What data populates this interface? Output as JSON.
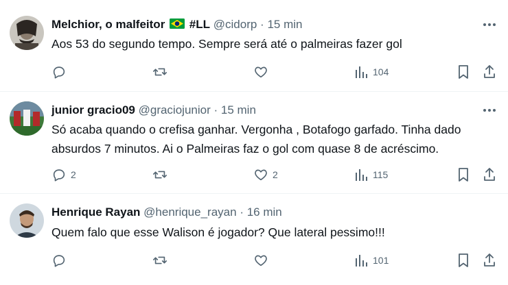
{
  "replies": [
    {
      "name": "Melchior, o malfeitor",
      "name_suffix": "#LL",
      "handle": "@cidorp",
      "separator": "·",
      "time": "15 min",
      "text": "Aos 53 do segundo tempo. Sempre será até o palmeiras fazer gol",
      "replies_count": "",
      "retweets_count": "",
      "likes_count": "",
      "views_count": "104"
    },
    {
      "name": "junior gracio09",
      "handle": "@graciojunior",
      "separator": "·",
      "time": "15 min",
      "text": "Só acaba quando o crefisa ganhar. Vergonha , Botafogo garfado. Tinha dado absurdos 7 minutos. Ai o Palmeiras faz o gol com quase 8 de acréscimo.",
      "replies_count": "2",
      "retweets_count": "",
      "likes_count": "2",
      "views_count": "115"
    },
    {
      "name": "Henrique Rayan",
      "handle": "@henrique_rayan",
      "separator": "·",
      "time": "16 min",
      "text": "Quem falo que esse Walison é jogador? Que lateral pessimo!!!",
      "replies_count": "",
      "retweets_count": "",
      "likes_count": "",
      "views_count": "101"
    }
  ],
  "icons": {
    "more": "more-horizontal-icon",
    "reply": "reply-bubble-icon",
    "retweet": "retweet-icon",
    "like": "heart-icon",
    "views": "bar-chart-icon",
    "bookmark": "bookmark-icon",
    "share": "share-icon"
  },
  "colors": {
    "text": "#0f1419",
    "secondary": "#536471",
    "divider": "#eff3f4",
    "flag_green": "#009c3b",
    "flag_yellow": "#ffdf00",
    "flag_blue": "#002776"
  }
}
